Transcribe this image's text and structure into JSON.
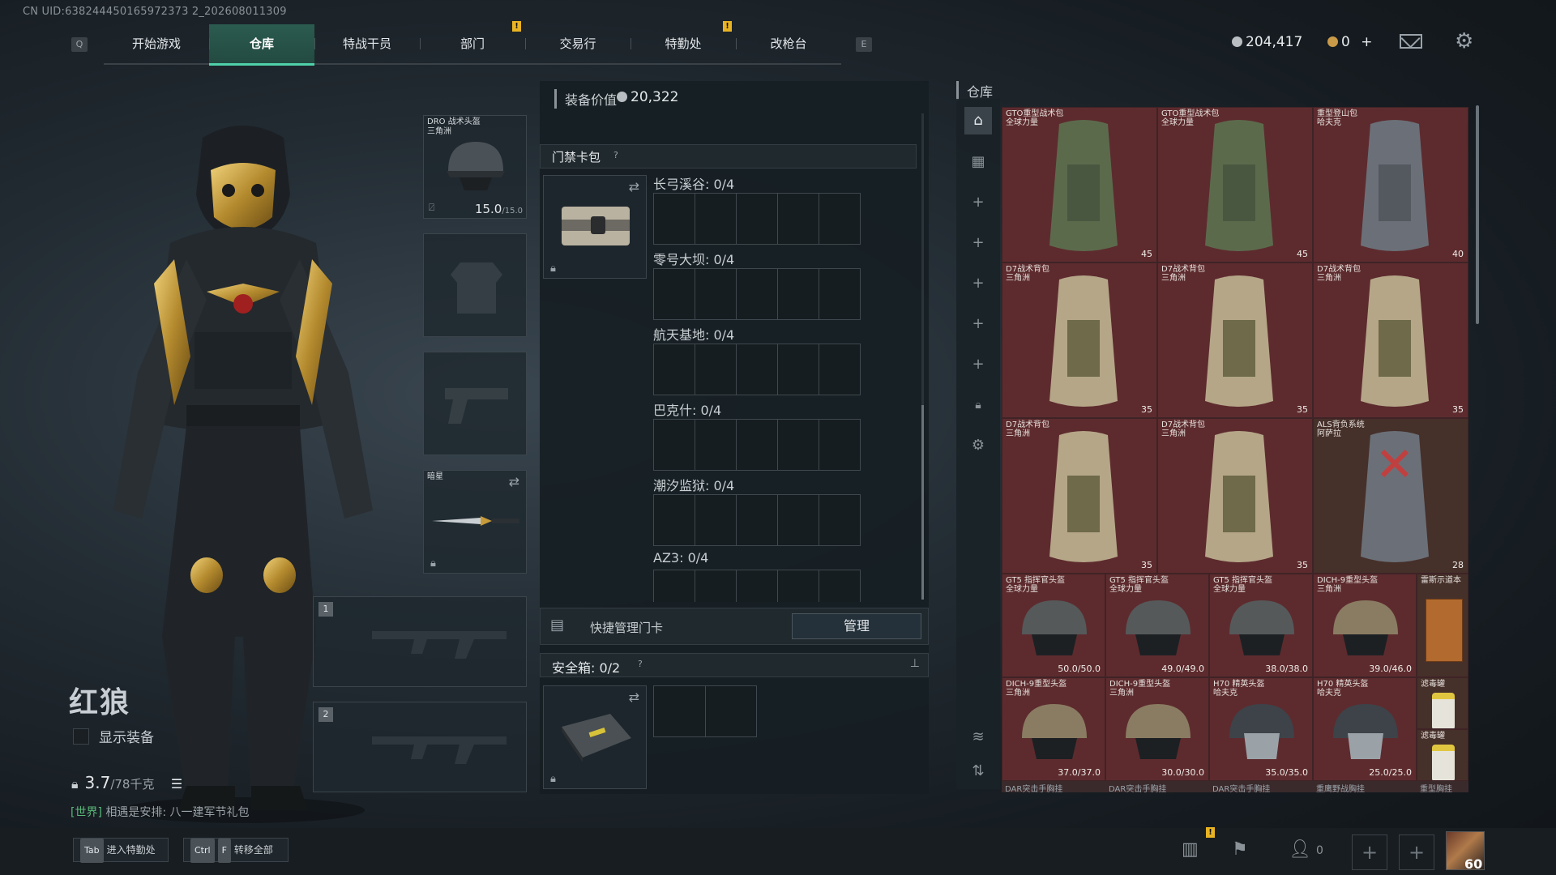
{
  "uid_text": "CN UID:638244450165972373 2_202608011309",
  "nav": {
    "q_key": "Q",
    "e_key": "E",
    "tabs": [
      "开始游戏",
      "仓库",
      "特战干员",
      "部门",
      "交易行",
      "特勤处",
      "改枪台"
    ],
    "active_tab": "仓库"
  },
  "currency": {
    "hafcoin": "204,417",
    "bonds": "0",
    "plus": "+"
  },
  "colors": {
    "accent": "#4fd1a8",
    "alert": "#e8b323",
    "item_bg": "#5d2b2e"
  },
  "operator": {
    "name": "红狼",
    "show_gear_label": "显示装备",
    "weight_value": "3.7",
    "weight_max": "/78千克",
    "world_tag": "[世界]",
    "world_msg": "相遇是安排: 八一建军节礼包"
  },
  "slots": {
    "helmet_label": "DRO 战术头盔",
    "helmet_sub": "三角洲",
    "helmet_durability": "15.0",
    "helmet_durability_max": "/15.0",
    "melee_label": "暗星",
    "primary_num": "1",
    "secondary_num": "2"
  },
  "middle": {
    "equip_value_label": "装备价值",
    "equip_value": "20,322",
    "keycard_title": "门禁卡包",
    "help": "?",
    "locations": [
      "长弓溪谷: 0/4",
      "零号大坝: 0/4",
      "航天基地: 0/4",
      "巴克什: 0/4",
      "潮汐监狱: 0/4",
      "AZ3: 0/4"
    ],
    "quick_manage_label": "快捷管理门卡",
    "manage_button": "管理",
    "safebox_label": "安全箱: 0/2"
  },
  "storage": {
    "title": "仓库",
    "items": [
      {
        "name": "GTO重型战术包",
        "sub": "全球力量",
        "qty": "45"
      },
      {
        "name": "GTO重型战术包",
        "sub": "全球力量",
        "qty": "45"
      },
      {
        "name": "重型登山包",
        "sub": "哈夫克",
        "qty": "40"
      },
      {
        "name": "D7战术背包",
        "sub": "三角洲",
        "qty": "35"
      },
      {
        "name": "D7战术背包",
        "sub": "三角洲",
        "qty": "35"
      },
      {
        "name": "D7战术背包",
        "sub": "三角洲",
        "qty": "35"
      },
      {
        "name": "D7战术背包",
        "sub": "三角洲",
        "qty": "35"
      },
      {
        "name": "D7战术背包",
        "sub": "三角洲",
        "qty": "35"
      },
      {
        "name": "ALS背负系统",
        "sub": "阿萨拉",
        "qty": "28"
      }
    ],
    "helmets": [
      {
        "name": "GT5 指挥官头盔",
        "sub": "全球力量",
        "qty": "50.0/50.0"
      },
      {
        "name": "GT5 指挥官头盔",
        "sub": "全球力量",
        "qty": "49.0/49.0"
      },
      {
        "name": "GT5 指挥官头盔",
        "sub": "全球力量",
        "qty": "38.0/38.0"
      },
      {
        "name": "DICH-9重型头盔",
        "sub": "三角洲",
        "qty": "39.0/46.0"
      },
      {
        "name": "DICH-9重型头盔",
        "sub": "三角洲",
        "qty": "37.0/37.0"
      },
      {
        "name": "DICH-9重型头盔",
        "sub": "三角洲",
        "qty": "30.0/30.0"
      },
      {
        "name": "H70 精英头盔",
        "sub": "哈夫克",
        "qty": "35.0/35.0"
      },
      {
        "name": "H70 精英头盔",
        "sub": "哈夫克",
        "qty": "25.0/25.0"
      }
    ],
    "notebook_label": "雷斯示道本",
    "filter_label_1": "滤毒罐",
    "filter_label_2": "滤毒罐",
    "bottom_row": [
      "DAR突击手胸挂",
      "DAR突击手胸挂",
      "DAR突击手胸挂",
      "重鹰野战胸挂",
      "重型胸挂"
    ]
  },
  "bottom": {
    "tab_key": "Tab",
    "tab_label": "进入特勤处",
    "ctrl_key": "Ctrl",
    "f_key": "F",
    "transfer_label": "转移全部",
    "friends_count": "0",
    "level": "60"
  }
}
